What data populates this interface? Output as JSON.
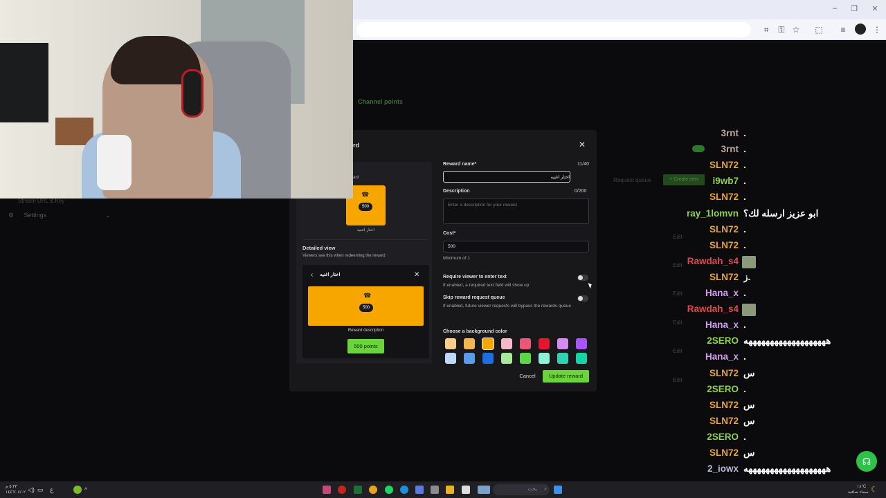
{
  "browser": {
    "window_controls": [
      "–",
      "❐",
      "✕"
    ],
    "toolbar_icons": [
      "translate-icon",
      "key-icon",
      "star-icon",
      "extensions-icon",
      "reading-list-icon",
      "profile-icon",
      "menu-icon"
    ]
  },
  "page": {
    "tab_channel_points": "Channel points",
    "sidebar": {
      "stream_url": "Stream URL & Key",
      "settings": "Settings"
    },
    "background": {
      "request_queue": "Request queue",
      "create_new": "+ Create new",
      "edit_labels": [
        "Edit",
        "Edit",
        "Edit",
        "Edit",
        "Edit",
        "Edit"
      ]
    }
  },
  "modal": {
    "title": "rd",
    "preview": {
      "top_label": "ard",
      "card_points": "500",
      "card_caption": "اختار اغنيه",
      "detailed_title": "Detailed view",
      "detailed_sub": "Viewers see this when redeeming the reward",
      "detail_title": "اختار اغنيه",
      "detail_points": "500",
      "reward_description": "Reward description",
      "points_button": "500 points"
    },
    "form": {
      "reward_name_label": "Reward name*",
      "reward_name_count": "11/40",
      "reward_name_value": "اختار اغنيه",
      "description_label": "Description",
      "description_count": "0/200",
      "description_placeholder": "Enter a description for your reward",
      "cost_label": "Cost*",
      "cost_value": "500",
      "cost_minimum": "Minimum of 1",
      "require_text_label": "Require viewer to enter text",
      "require_text_help": "If enabled, a required text field will show up",
      "require_text_enabled": false,
      "skip_queue_label": "Skip reward request queue",
      "skip_queue_help": "If enabled, future viewer requests will bypass the rewards queue",
      "skip_queue_enabled": false,
      "bg_color_label": "Choose a background color",
      "colors": [
        "#f8cf8a",
        "#f5b64f",
        "#f7a600",
        "#f4b8c9",
        "#e9587a",
        "#e2172f",
        "#d58cf0",
        "#a855f7",
        "#bfdaf7",
        "#5a9bea",
        "#1d6fe0",
        "#a9e89a",
        "#5fd64a",
        "#8ef0d6",
        "#2fd3b4",
        "#16d3a8"
      ],
      "selected_color": "#f7a600",
      "cancel": "Cancel",
      "update": "Update reward"
    }
  },
  "chat": [
    {
      "user": "3rnt",
      "color": "#b8a6a0",
      "msg": "."
    },
    {
      "user": "3rnt",
      "color": "#b8a6a0",
      "msg": "."
    },
    {
      "user": "SLN72",
      "color": "#e8a33a",
      "msg": "."
    },
    {
      "user": "i9wb7",
      "color": "#8fd14f",
      "msg": "."
    },
    {
      "user": "SLN72",
      "color": "#e8a33a",
      "msg": "."
    },
    {
      "user": "ray_1lomvn",
      "color": "#8fd14f",
      "msg": "ابو عزيز ارسله لك؟"
    },
    {
      "user": "SLN72",
      "color": "#e8a33a",
      "msg": "."
    },
    {
      "user": "SLN72",
      "color": "#e8a33a",
      "msg": "."
    },
    {
      "user": "Rawdah_s4",
      "color": "#e04a4a",
      "msg": "",
      "emote": true
    },
    {
      "user": "SLN72",
      "color": "#e8a33a",
      "msg": "ز."
    },
    {
      "user": "Hana_x",
      "color": "#d39df0",
      "msg": "."
    },
    {
      "user": "Rawdah_s4",
      "color": "#e04a4a",
      "msg": "",
      "emote": true
    },
    {
      "user": "Hana_x",
      "color": "#d39df0",
      "msg": "."
    },
    {
      "user": "2SERO",
      "color": "#8fd14f",
      "msg": "هههههههههههههههههههه"
    },
    {
      "user": "Hana_x",
      "color": "#d39df0",
      "msg": "."
    },
    {
      "user": "SLN72",
      "color": "#e8a33a",
      "msg": "س"
    },
    {
      "user": "2SERO",
      "color": "#8fd14f",
      "msg": "."
    },
    {
      "user": "SLN72",
      "color": "#e8a33a",
      "msg": "س"
    },
    {
      "user": "SLN72",
      "color": "#e8a33a",
      "msg": "س"
    },
    {
      "user": "2SERO",
      "color": "#8fd14f",
      "msg": "."
    },
    {
      "user": "SLN72",
      "color": "#e8a33a",
      "msg": "س"
    },
    {
      "user": "2_iowx",
      "color": "#b8b8d6",
      "msg": "هههههههههههههههههههه"
    }
  ],
  "taskbar": {
    "clock_time": "٥:٣٣ م",
    "clock_date": "١٤٤٦/٠٤/٠٢",
    "weather": "١٨°C",
    "weather_desc": "سماء صافية",
    "search_placeholder": "بحث"
  }
}
